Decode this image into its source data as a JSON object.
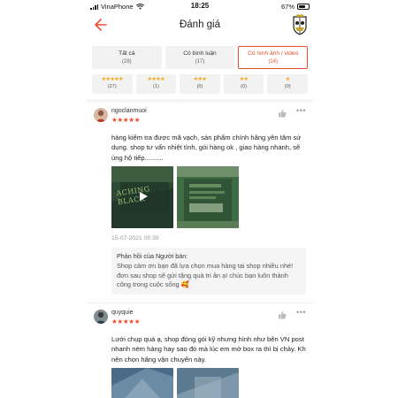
{
  "status_bar": {
    "carrier": "VinaPhone",
    "time": "18:25",
    "battery": "67%",
    "battery_level": 0.67
  },
  "header": {
    "title": "Đánh giá",
    "back_icon": "back-arrow-icon",
    "logo_icon": "shop-logo-icon",
    "accent_color": "#ee4d2d"
  },
  "filters": {
    "tabs": [
      {
        "label": "Tất cả",
        "count": "(28)",
        "active": false
      },
      {
        "label": "Có bình luận",
        "count": "(17)",
        "active": false
      },
      {
        "label": "Có hình ảnh / video",
        "count": "(14)",
        "active": true
      }
    ],
    "star_filters": [
      {
        "stars": "★★★★★",
        "count": "(27)"
      },
      {
        "stars": "★★★★",
        "count": "(1)"
      },
      {
        "stars": "★★★",
        "count": "(0)"
      },
      {
        "stars": "★★",
        "count": "(0)"
      },
      {
        "stars": "★",
        "count": "(0)"
      }
    ],
    "star_color": "#ffa200"
  },
  "reviews": [
    {
      "username": "ngoclanmuoi",
      "stars": "★★★★★",
      "rating": 5,
      "text": "hàng kiểm tra được mã vạch, sản phẩm chính hãng yên tâm sử dụng. shop tư vấn nhiệt tình, gói hàng ok , giao hàng nhanh, sẽ ủng hộ tiếp..........",
      "thumb1_caption": "ACHING BLACK",
      "date": "15-07-2021 05:39",
      "reply_label": "Phản hồi của Người bán:",
      "reply_text": "Shop cảm ơn bạn đã lựa chọn mua hàng tại shop nhiều nhé! đơn sau shop sẽ gửi tặng quà tri ân ạ! chúc bạn luôn thành công trong cuộc sống 🥰"
    },
    {
      "username": "quyquie",
      "stars": "★★★★★",
      "rating": 5,
      "text": "Lưới chụp quá ạ, shop đóng gói kỹ nhưng hình như bên VN post nhanh ném hàng hay sao đó mà lúc em mở box ra thì bị chảy. Kh nên chọn hãng vận chuyển này."
    }
  ]
}
